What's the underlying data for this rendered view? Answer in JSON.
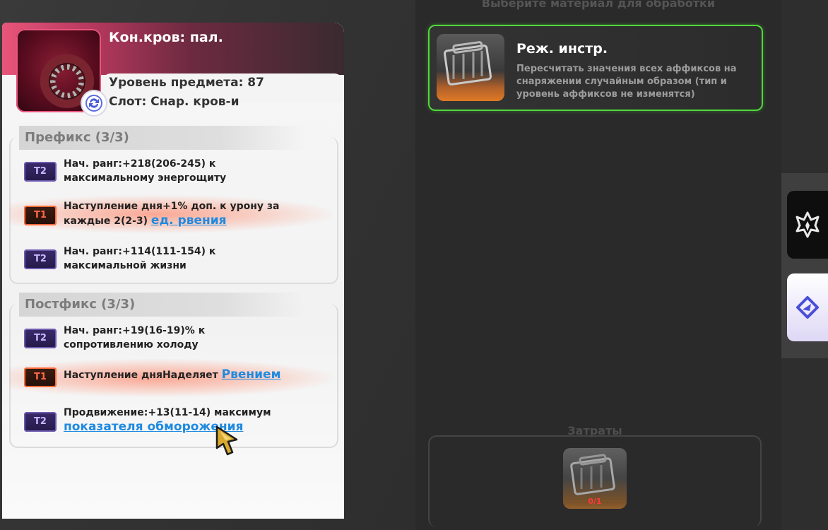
{
  "item": {
    "name": "Кон.кров: пал.",
    "level": "Уровень предмета: 87",
    "slot": "Слот: Снар. кров-и"
  },
  "prefix": {
    "title": "Префикс (3/3)",
    "affixes": [
      {
        "tier": "T2",
        "text": "Нач. ранг:+218(206-245) к максимальному энергощиту",
        "link": ""
      },
      {
        "tier": "T1",
        "text": "Наступление дня+1% доп. к урону за каждые 2(2-3) ",
        "link": "ед. рвения"
      },
      {
        "tier": "T2",
        "text": "Нач. ранг:+114(111-154) к максимальной жизни",
        "link": ""
      }
    ]
  },
  "suffix": {
    "title": "Постфикс (3/3)",
    "affixes": [
      {
        "tier": "T2",
        "text": "Нач. ранг:+19(16-19)% к сопротивлению холоду",
        "link": ""
      },
      {
        "tier": "T1",
        "text": "Наступление дняНаделяет ",
        "link": "Рвением"
      },
      {
        "tier": "T2",
        "text": "Продвижение:+13(11-14) максимум ",
        "link": "показателя обморожения"
      }
    ]
  },
  "material_panel": {
    "title": "Выберите материал для обработки",
    "material": {
      "name": "Реж. инстр.",
      "description": "Пересчитать значения всех аффиксов на снаряжении случайным образом (тип и уровень аффиксов не изменятся)"
    },
    "cost_label": "Затраты",
    "cost_count": "0/1"
  },
  "icons": {
    "item": "crimson-ring-icon",
    "badge": "sync-icon",
    "material": "tool-kit-icon",
    "tab_dark": "crest-emblem-icon",
    "tab_light": "compass-rune-icon"
  },
  "colors": {
    "accent_green": "#4fd93a",
    "link_blue": "#1f8ae0",
    "tier1": "#ff6b3b",
    "tier2": "#6d5bb0"
  }
}
